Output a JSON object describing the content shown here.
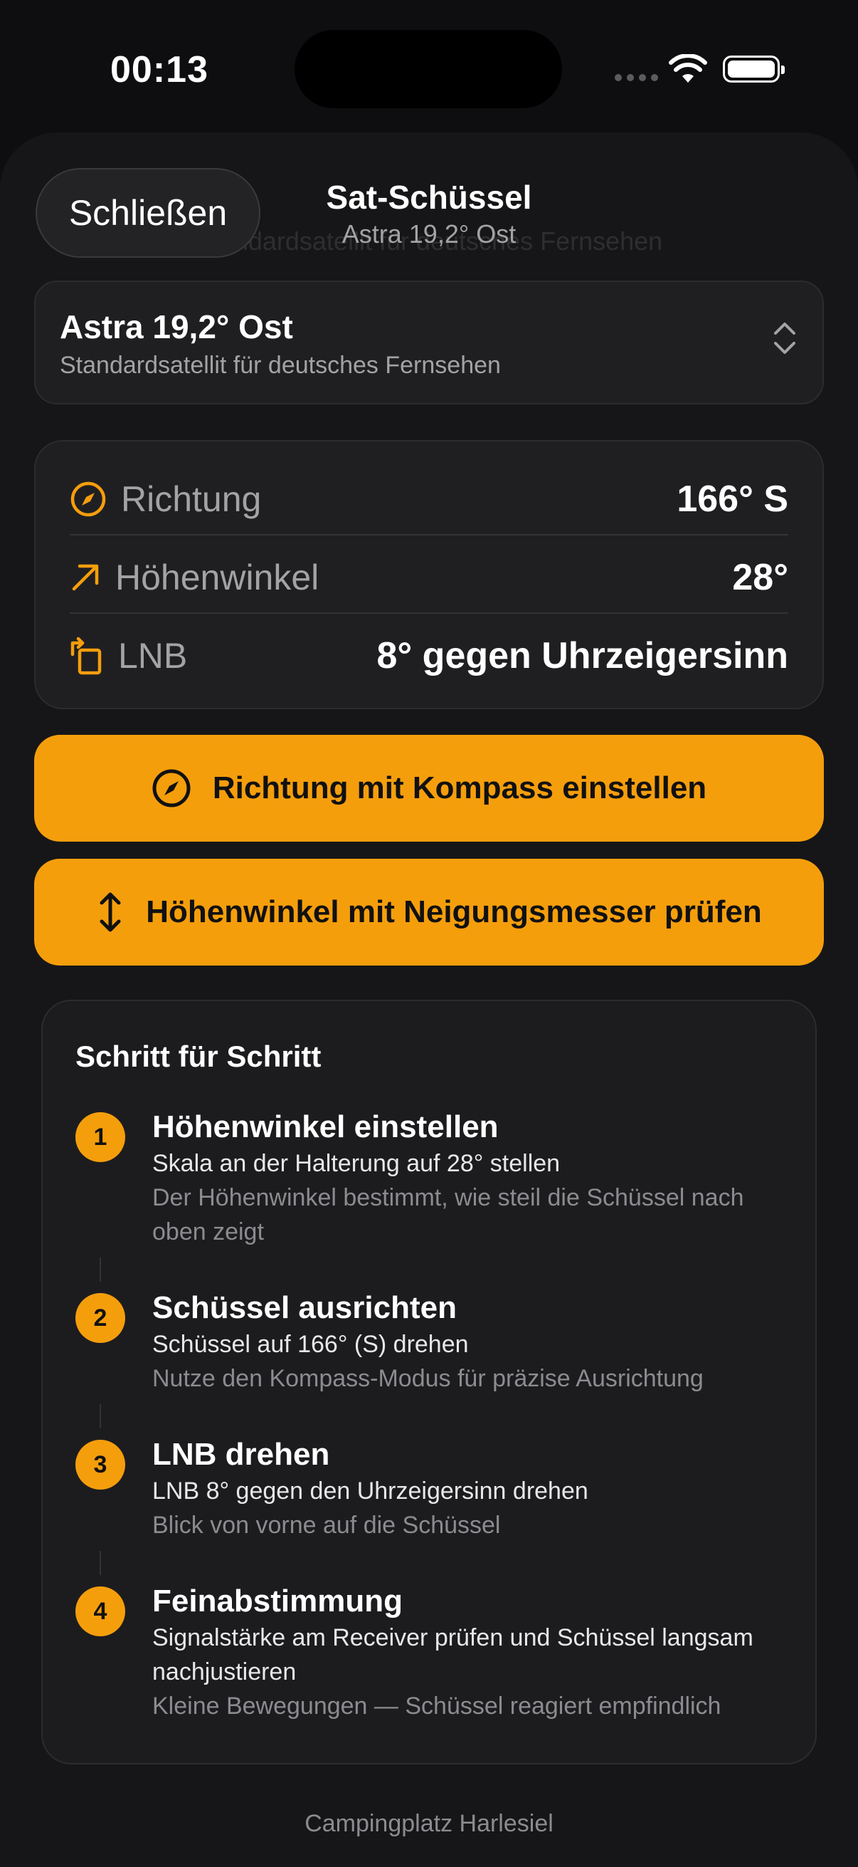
{
  "status_bar": {
    "time": "00:13"
  },
  "header": {
    "close_label": "Schließen",
    "title": "Sat-Schüssel",
    "subtitle": "Astra 19,2° Ost",
    "ghost_text": "Standardsatellit für deutsches Fernsehen"
  },
  "satellite": {
    "name": "Astra 19,2° Ost",
    "description": "Standardsatellit für deutsches Fernsehen"
  },
  "values": [
    {
      "icon": "compass-icon",
      "label": "Richtung",
      "value": "166° S"
    },
    {
      "icon": "arrow-up-right-icon",
      "label": "Höhenwinkel",
      "value": "28°"
    },
    {
      "icon": "rotate-icon",
      "label": "LNB",
      "value": "8° gegen Uhrzeigersinn"
    }
  ],
  "actions": {
    "compass_label": "Richtung mit Kompass einstellen",
    "inclinometer_label": "Höhenwinkel mit Neigungsmesser prüfen"
  },
  "steps": {
    "title": "Schritt für Schritt",
    "items": [
      {
        "num": "1",
        "title": "Höhenwinkel einstellen",
        "instruction": "Skala an der Halterung auf 28° stellen",
        "hint": "Der Höhenwinkel bestimmt, wie steil die Schüssel nach oben zeigt"
      },
      {
        "num": "2",
        "title": "Schüssel ausrichten",
        "instruction": "Schüssel auf 166° (S) drehen",
        "hint": "Nutze den Kompass-Modus für präzise Ausrichtung"
      },
      {
        "num": "3",
        "title": "LNB drehen",
        "instruction": "LNB 8° gegen den Uhrzeigersinn drehen",
        "hint": "Blick von vorne auf die Schüssel"
      },
      {
        "num": "4",
        "title": "Feinabstimmung",
        "instruction": "Signalstärke am Receiver prüfen und Schüssel langsam nachjustieren",
        "hint": "Kleine Bewegungen — Schüssel reagiert empfindlich"
      }
    ]
  },
  "footer": {
    "location": "Campingplatz Harlesiel"
  },
  "colors": {
    "accent": "#f59e0c",
    "background": "#0e0e10",
    "card": "#1f1f22"
  }
}
